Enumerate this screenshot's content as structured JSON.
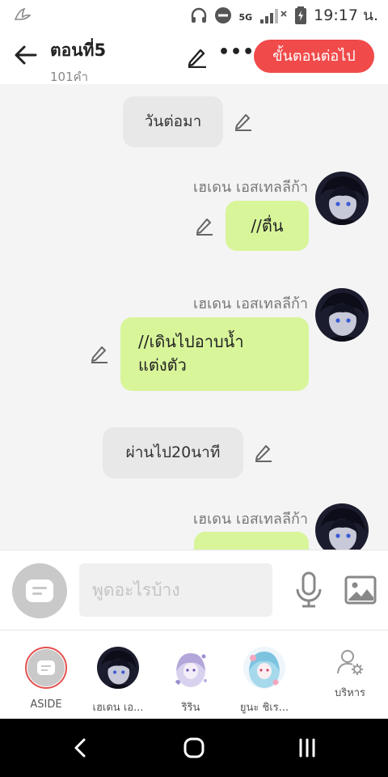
{
  "status_bar": {
    "network": "5G",
    "time": "19:17 น."
  },
  "header": {
    "title": "ตอนที่5",
    "word_count": "101คำ",
    "next_button": "ขั้นตอนต่อไป"
  },
  "messages": {
    "narration_1": "วันต่อมา",
    "speaker_1": "เฮเดน เอสเทลลีก้า",
    "message_1": "//ตื่น",
    "speaker_2": "เฮเดน เอสเทลลีก้า",
    "message_2": "//เดินไปอาบน้ำแต่งตัว",
    "narration_2": "ผ่านไป20นาที",
    "speaker_3": "เฮเดน เอสเทลลีก้า"
  },
  "input": {
    "placeholder": "พูดอะไรบ้าง"
  },
  "characters": [
    {
      "name": "ASIDE"
    },
    {
      "name": "เฮเดน เอ..."
    },
    {
      "name": "ริริน"
    },
    {
      "name": "ยูนะ ชิเร..."
    },
    {
      "name": "บริหาร"
    }
  ],
  "colors": {
    "accent": "#f04a4a",
    "bubble": "#d8f59a",
    "narration": "#e8e8e8"
  }
}
